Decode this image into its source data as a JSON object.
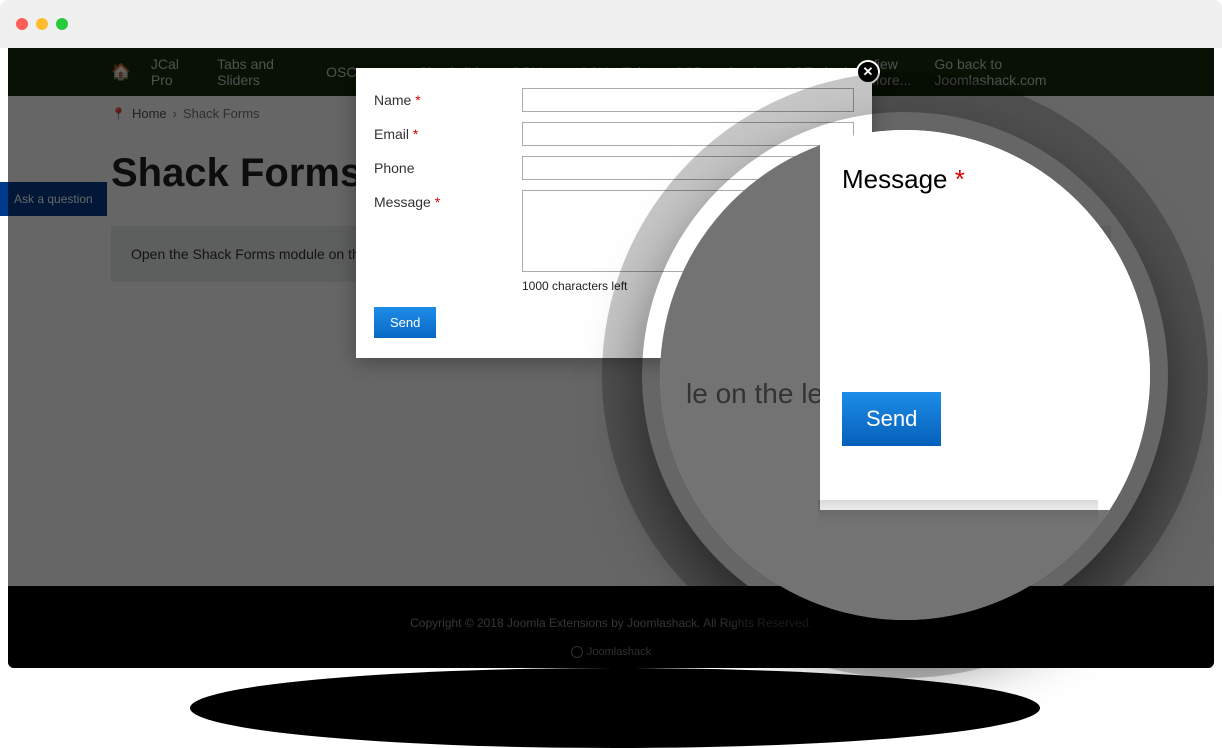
{
  "nav": {
    "items": [
      "JCal Pro",
      "Tabs and Sliders",
      "OSCampus",
      "Shackslider",
      "OSMap",
      "OSYouTube",
      "OSDownloads",
      "OSEmbed",
      "View More..."
    ],
    "goback": "Go back to Joomlashack.com"
  },
  "breadcrumb": {
    "home": "Home",
    "current": "Shack Forms"
  },
  "page": {
    "title": "Shack Forms Demo",
    "ask_tab": "Ask a question",
    "infobox": "Open the Shack Forms module on the left"
  },
  "form": {
    "name_label": "Name",
    "email_label": "Email",
    "phone_label": "Phone",
    "message_label": "Message",
    "chars_left": "1000 characters left",
    "send": "Send"
  },
  "magnifier": {
    "message_label": "Message",
    "send": "Send",
    "bg_text": "le on the left",
    "big_text": "e"
  },
  "footer": {
    "copyright": "Copyright © 2018 Joomla Extensions by Joomlashack. All Rights Reserved.",
    "logo": "Joomlashack"
  }
}
